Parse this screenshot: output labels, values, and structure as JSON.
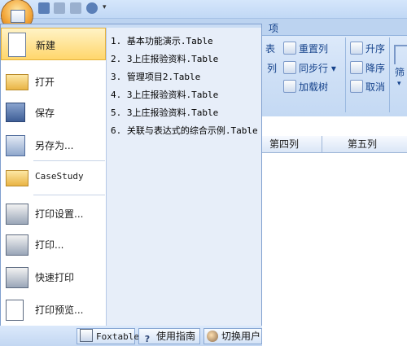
{
  "ribbon": {
    "tab_partial": "项",
    "col1": [
      "表",
      "列"
    ],
    "col2": [
      "重置列",
      "同步行 ▾",
      "加载树"
    ],
    "col3": [
      "升序",
      "降序",
      "取消"
    ],
    "col4": "筛"
  },
  "grid": {
    "headers": [
      "第四列",
      "第五列"
    ]
  },
  "menu": {
    "items": [
      "新建",
      "打开",
      "保存",
      "另存为...",
      "CaseStudy",
      "打印设置...",
      "打印...",
      "快速打印",
      "打印预览..."
    ],
    "recent": [
      "1. 基本功能演示.Table",
      "2. 3上庄报验资料.Table",
      "3. 管理项目2.Table",
      "4. 3上庄报验资料.Table",
      "5. 3上庄报验资料.Table",
      "6. 关联与表达式的综合示例.Table"
    ],
    "bottom_buttons": [
      "Foxtable",
      "使用指南",
      "切换用户"
    ]
  }
}
